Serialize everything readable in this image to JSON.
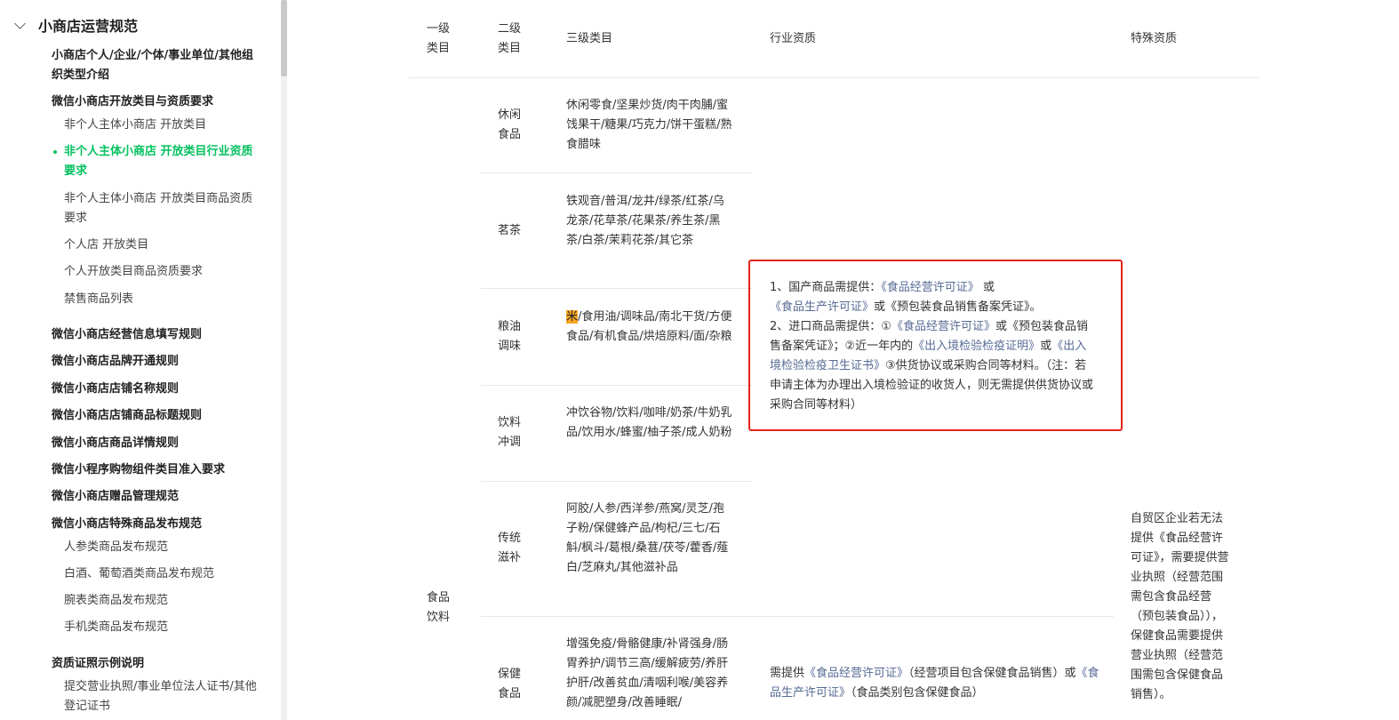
{
  "sidebar": {
    "section_title": "小商店运营规范",
    "items": [
      {
        "label": "小商店个人/企业/个体/事业单位/其他组织类型介绍"
      },
      {
        "label": "微信小商店开放类目与资质要求"
      },
      {
        "label": "非个人主体小商店 开放类目"
      },
      {
        "label": "非个人主体小商店 开放类目行业资质要求"
      },
      {
        "label": "非个人主体小商店 开放类目商品资质要求"
      },
      {
        "label": "个人店 开放类目"
      },
      {
        "label": "个人开放类目商品资质要求"
      },
      {
        "label": "禁售商品列表"
      },
      {
        "label": "微信小商店经营信息填写规则"
      },
      {
        "label": "微信小商店品牌开通规则"
      },
      {
        "label": "微信小商店店铺名称规则"
      },
      {
        "label": "微信小商店店铺商品标题规则"
      },
      {
        "label": "微信小商店商品详情规则"
      },
      {
        "label": "微信小程序购物组件类目准入要求"
      },
      {
        "label": "微信小商店赠品管理规范"
      },
      {
        "label": "微信小商店特殊商品发布规范"
      },
      {
        "label": "人参类商品发布规范"
      },
      {
        "label": "白酒、葡萄酒类商品发布规范"
      },
      {
        "label": "腕表类商品发布规范"
      },
      {
        "label": "手机类商品发布规范"
      },
      {
        "label": "资质证照示例说明"
      },
      {
        "label": "提交营业执照/事业单位法人证书/其他登记证书"
      }
    ]
  },
  "table": {
    "headers": [
      "一级类目",
      "二级类目",
      "三级类目",
      "行业资质",
      "特殊资质"
    ],
    "level1": "食品饮料",
    "rows": [
      {
        "level2": "休闲食品",
        "level3": "休闲零食/坚果炒货/肉干肉脯/蜜饯果干/糖果/巧克力/饼干蛋糕/熟食腊味"
      },
      {
        "level2": "茗茶",
        "level3": "铁观音/普洱/龙井/绿茶/红茶/乌龙茶/花草茶/花果茶/养生茶/黑茶/白茶/茉莉花茶/其它茶"
      },
      {
        "level2": "粮油调味",
        "level3_highlight": "米",
        "level3": "/食用油/调味品/南北干货/方便食品/有机食品/烘焙原料/面/杂粮"
      },
      {
        "level2": "饮料冲调",
        "level3": "冲饮谷物/饮料/咖啡/奶茶/牛奶乳品/饮用水/蜂蜜/柚子茶/成人奶粉"
      },
      {
        "level2": "传统滋补",
        "level3": "阿胶/人参/西洋参/燕窝/灵芝/孢子粉/保健蜂产品/枸杞/三七/石斛/枫斗/葛根/桑葚/茯苓/藿香/薤白/芝麻丸/其他滋补品"
      },
      {
        "level2": "保健食品",
        "level3": "增强免疫/骨骼健康/补肾强身/肠胃养护/调节三高/缓解疲劳/养肝护肝/改善贫血/清咽利喉/美容养颜/减肥塑身/改善睡眠/"
      }
    ],
    "qualification_food": {
      "p1_pre": "1、国产商品需提供：",
      "p1_link1": "《食品经营许可证》",
      "p1_mid": "或",
      "p1_link2": "《食品生产许可证》",
      "p1_post": "或《预包装食品销售备案凭证》。",
      "p2_pre": "2、进口商品需提供：①",
      "p2_link1": "《食品经营许可证》",
      "p2_mid1": "或《预包装食品销售备案凭证》；②近一年内的",
      "p2_link2": "《出入境检验检疫证明》",
      "p2_mid2": "或",
      "p2_link3": "《出入境检验检疫卫生证书》",
      "p2_post": "③供货协议或采购合同等材料。（注：若申请主体为办理出入境检验证的收货人，则无需提供供货协议或采购合同等材料）"
    },
    "qualification_health": {
      "pre": "需提供",
      "link1": "《食品经营许可证》",
      "mid": "（经营项目包含保健食品销售）或",
      "link2": "《食品生产许可证》",
      "post": "（食品类别包含保健食品）"
    },
    "special_qualification": "自贸区企业若无法提供《食品经营许可证》，需要提供营业执照（经营范围需包含食品经营（预包装食品）），保健食品需要提供营业执照（经营范围需包含保健食品销售）。"
  },
  "colors": {
    "accent_active": "#07c160",
    "link": "#576b95",
    "highlight_box": "#e1251b",
    "text_highlight": "#f5a623"
  },
  "icons": [
    "chevron-down-icon"
  ]
}
